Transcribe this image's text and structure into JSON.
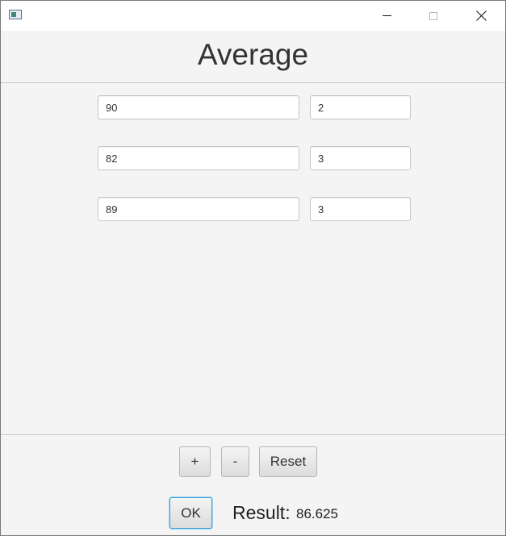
{
  "window": {
    "app_icon": "java-window-icon",
    "controls": [
      "minimize-icon",
      "maximize-icon",
      "close-icon"
    ]
  },
  "header": {
    "title": "Average"
  },
  "rows": [
    {
      "grade": "90",
      "weight": "2"
    },
    {
      "grade": "82",
      "weight": "3"
    },
    {
      "grade": "89",
      "weight": "3"
    }
  ],
  "footer": {
    "add_label": "+",
    "remove_label": "-",
    "reset_label": "Reset",
    "ok_label": "OK",
    "result_label": "Result:",
    "result_value": "86.625"
  },
  "colors": {
    "background": "#f4f4f4",
    "focus_accent": "#3aa0dc"
  }
}
